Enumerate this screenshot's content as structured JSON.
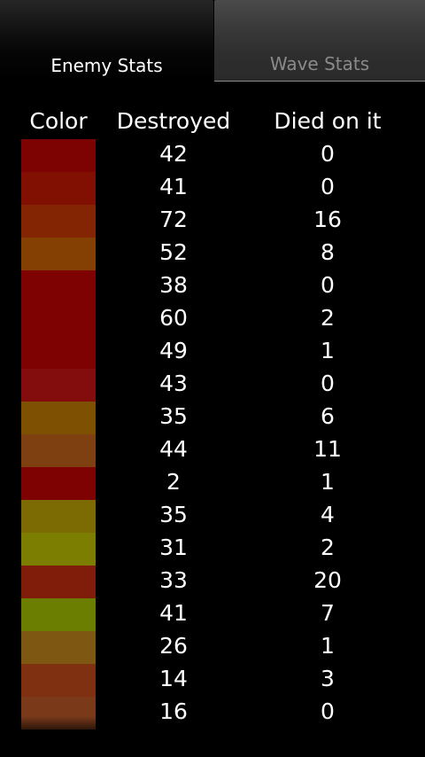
{
  "tabs": {
    "enemy_stats": "Enemy Stats",
    "wave_stats": "Wave Stats"
  },
  "table": {
    "headers": {
      "color": "Color",
      "destroyed": "Destroyed",
      "died_on_it": "Died on it"
    },
    "rows": [
      {
        "color": "#7d0202",
        "destroyed": "42",
        "died": "0"
      },
      {
        "color": "#821002",
        "destroyed": "41",
        "died": "0"
      },
      {
        "color": "#832402",
        "destroyed": "72",
        "died": "16"
      },
      {
        "color": "#834002",
        "destroyed": "52",
        "died": "8"
      },
      {
        "color": "#7f0202",
        "destroyed": "38",
        "died": "0"
      },
      {
        "color": "#7f0202",
        "destroyed": "60",
        "died": "2"
      },
      {
        "color": "#7f0202",
        "destroyed": "49",
        "died": "1"
      },
      {
        "color": "#830c0c",
        "destroyed": "43",
        "died": "0"
      },
      {
        "color": "#7e5002",
        "destroyed": "35",
        "died": "6"
      },
      {
        "color": "#7e4010",
        "destroyed": "44",
        "died": "11"
      },
      {
        "color": "#7f0202",
        "destroyed": "2",
        "died": "1"
      },
      {
        "color": "#7c6a02",
        "destroyed": "35",
        "died": "4"
      },
      {
        "color": "#7c7e02",
        "destroyed": "31",
        "died": "2"
      },
      {
        "color": "#801c0a",
        "destroyed": "33",
        "died": "20"
      },
      {
        "color": "#6c7e02",
        "destroyed": "41",
        "died": "7"
      },
      {
        "color": "#7e5812",
        "destroyed": "26",
        "died": "1"
      },
      {
        "color": "#7e3010",
        "destroyed": "14",
        "died": "3"
      },
      {
        "color": "#7a3a1a",
        "destroyed": "16",
        "died": "0"
      }
    ]
  }
}
